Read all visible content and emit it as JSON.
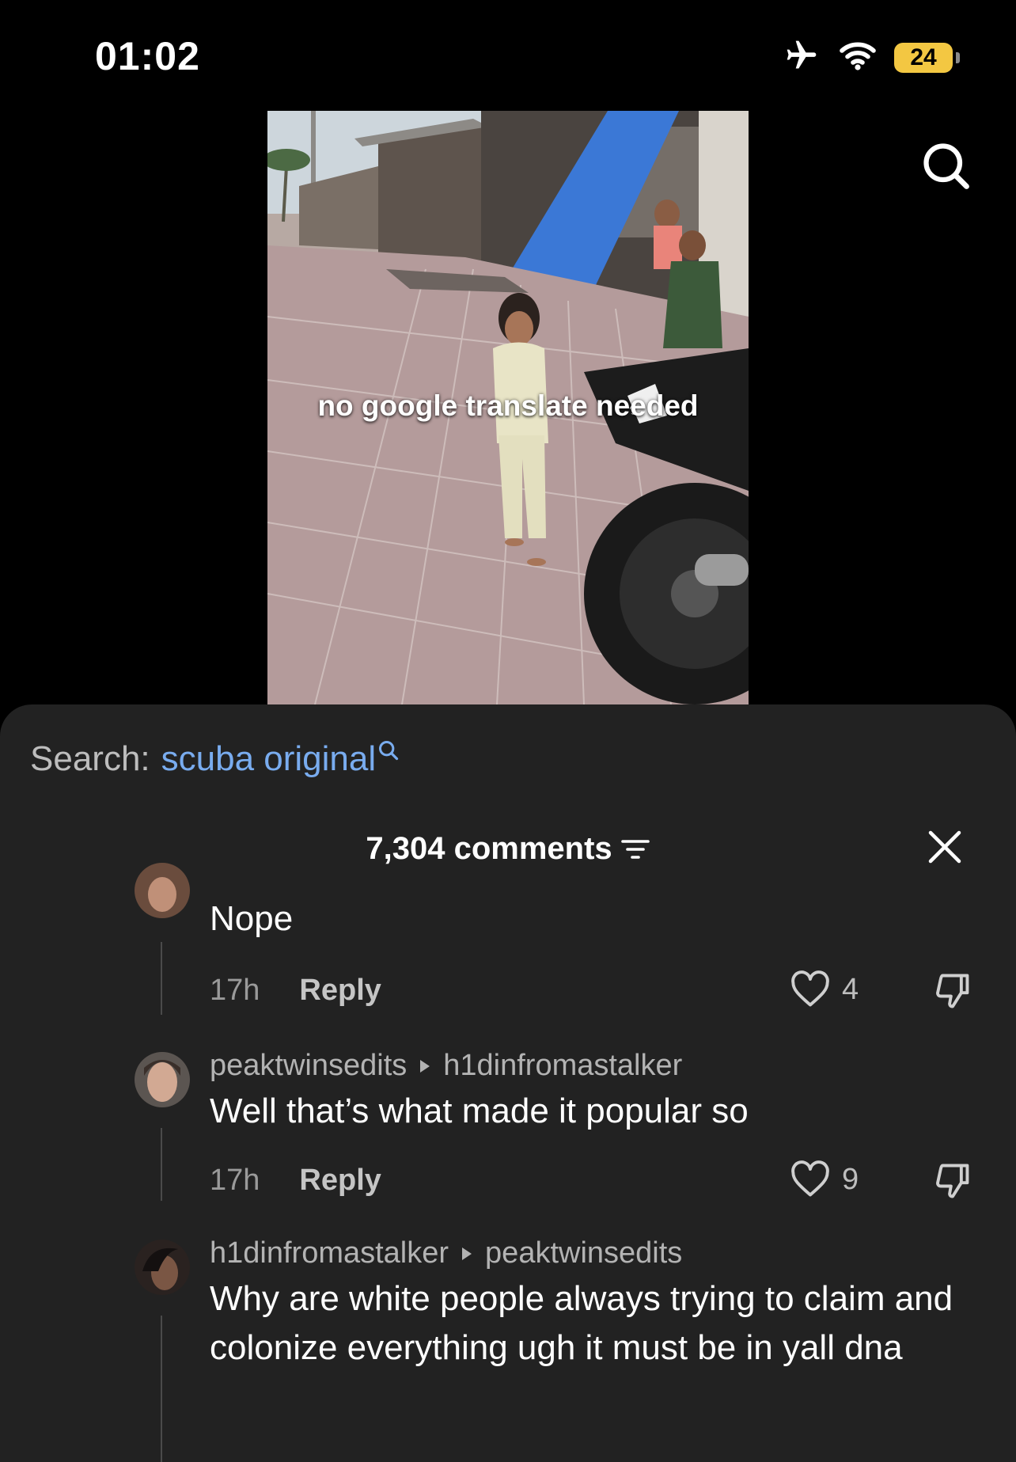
{
  "status_bar": {
    "time": "01:02",
    "battery": "24",
    "icons": [
      "airplane-icon",
      "wifi-icon",
      "battery-icon"
    ]
  },
  "video": {
    "caption": "no google translate needed",
    "plate_text": "36PY"
  },
  "search": {
    "label": "Search:",
    "term": "scuba original"
  },
  "comments_panel": {
    "count_label": "7,304 comments"
  },
  "comments": [
    {
      "text": "Nope",
      "time": "17h",
      "reply_label": "Reply",
      "likes": "4"
    },
    {
      "user": "peaktwinsedits",
      "reply_to": "h1dinfromastalker",
      "text": "Well that’s what made it popular so",
      "time": "17h",
      "reply_label": "Reply",
      "likes": "9"
    },
    {
      "user": "h1dinfromastalker",
      "reply_to": "peaktwinsedits",
      "text": "Why are white people always trying to claim and colonize everything ugh it must be in yall dna"
    }
  ],
  "colors": {
    "sheet_bg": "#222222",
    "search_term": "#79acef",
    "battery": "#f3c742"
  }
}
